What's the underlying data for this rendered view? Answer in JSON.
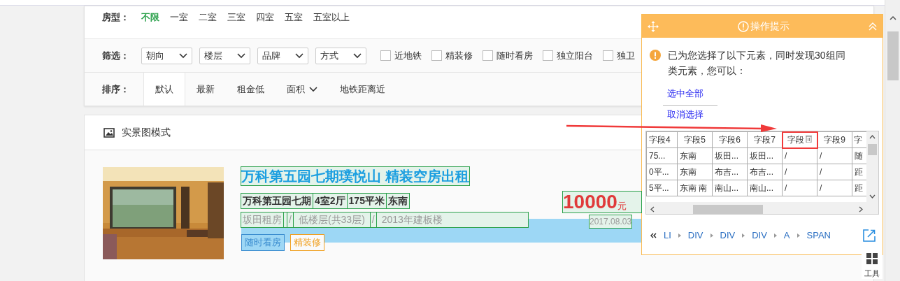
{
  "house_type": {
    "label": "房型：",
    "options": [
      {
        "label": "不限",
        "selected": true
      },
      {
        "label": "一室",
        "selected": false
      },
      {
        "label": "二室",
        "selected": false
      },
      {
        "label": "三室",
        "selected": false
      },
      {
        "label": "四室",
        "selected": false
      },
      {
        "label": "五室",
        "selected": false
      },
      {
        "label": "五室以上",
        "selected": false
      }
    ]
  },
  "filters": {
    "label": "筛选：",
    "dropdowns": [
      "朝向",
      "楼层",
      "品牌",
      "方式"
    ],
    "checkboxes": [
      {
        "label": "近地铁",
        "checked": false
      },
      {
        "label": "精装修",
        "checked": false
      },
      {
        "label": "随时看房",
        "checked": false
      },
      {
        "label": "独立阳台",
        "checked": false
      },
      {
        "label": "独卫",
        "checked": false
      }
    ]
  },
  "sort": {
    "label": "排序：",
    "options": [
      {
        "label": "默认",
        "selected": true,
        "kind": "plain"
      },
      {
        "label": "最新",
        "selected": false,
        "kind": "plain"
      },
      {
        "label": "租金低",
        "selected": false,
        "kind": "plain"
      },
      {
        "label": "面积",
        "selected": false,
        "kind": "dropdown"
      },
      {
        "label": "地铁距离近",
        "selected": false,
        "kind": "plain"
      }
    ]
  },
  "view_mode": {
    "label": "实景图模式"
  },
  "listing": {
    "title": "万科第五园七期璞悦山 精装空房出租",
    "details": [
      "万科第五园七期",
      "4室2厅",
      "175平米",
      "东南"
    ],
    "location": [
      "坂田租房",
      "/",
      "低楼层(共33层)",
      "/",
      "2013年建板楼"
    ],
    "tags": [
      {
        "label": "随时看房",
        "color": "#3a8ccf"
      },
      {
        "label": "精装修",
        "color": "#f0a020"
      }
    ],
    "price": "10000",
    "unit": "元",
    "date": "2017.08.03"
  },
  "popup": {
    "title": "操作提示",
    "message": "已为您选择了以下元素，同时发现30组同类元素，您可以：",
    "actions": [
      "选中全部",
      "取消选择"
    ],
    "table": {
      "columns": [
        "字段4",
        "字段5",
        "字段6",
        "字段7",
        "字段",
        "字段9",
        "字"
      ],
      "rows": [
        [
          "75...",
          "东南",
          "坂田...",
          "坂田...",
          "/",
          "/",
          "随"
        ],
        [
          "0平...",
          "东南",
          "布吉...",
          "布吉...",
          "/",
          "/",
          "距"
        ],
        [
          "5平...",
          "东南 南",
          "南山...",
          "南山...",
          "/",
          "/",
          "距"
        ]
      ]
    },
    "breadcrumb": [
      "LI",
      "DIV",
      "DIV",
      "DIV",
      "A",
      "SPAN"
    ]
  },
  "tools": {
    "label": "工具"
  }
}
